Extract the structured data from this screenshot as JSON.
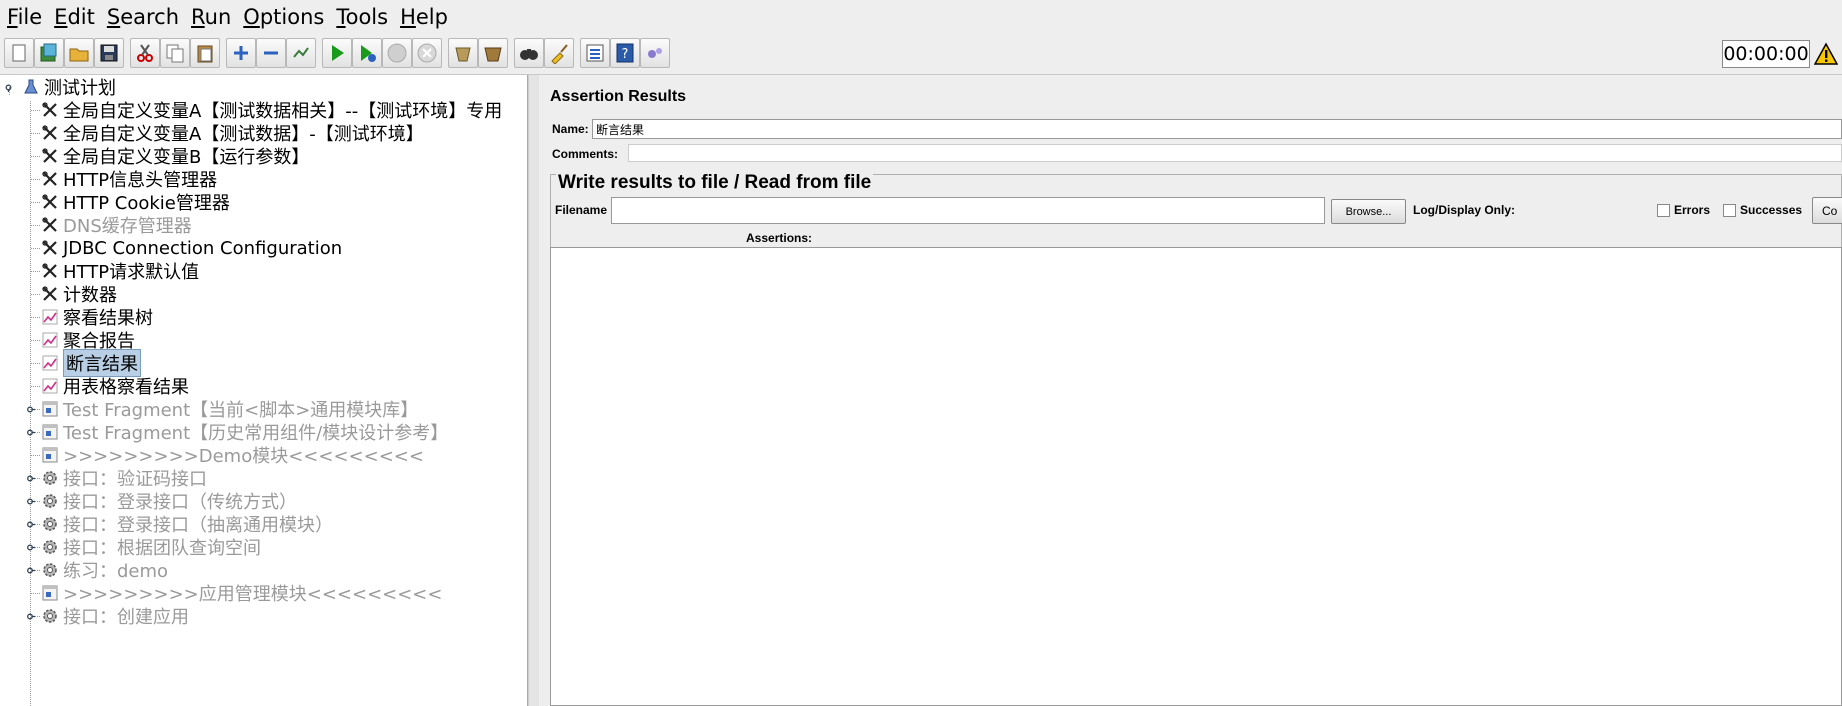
{
  "menubar": {
    "items": [
      {
        "accel": "F",
        "rest": "ile"
      },
      {
        "accel": "E",
        "rest": "dit"
      },
      {
        "accel": "S",
        "rest": "earch"
      },
      {
        "accel": "R",
        "rest": "un"
      },
      {
        "accel": "O",
        "rest": "ptions"
      },
      {
        "accel": "T",
        "rest": "ools"
      },
      {
        "accel": "H",
        "rest": "elp"
      }
    ]
  },
  "toolbar": {
    "timer": "00:00:00"
  },
  "tree": {
    "root": "测试计划",
    "items": [
      {
        "label": "全局自定义变量A【测试数据相关】--【测试环境】专用",
        "icon": "wrench-icon",
        "disabled": false
      },
      {
        "label": "全局自定义变量A【测试数据】-【测试环境】",
        "icon": "wrench-icon",
        "disabled": false
      },
      {
        "label": "全局自定义变量B【运行参数】",
        "icon": "wrench-icon",
        "disabled": false
      },
      {
        "label": "HTTP信息头管理器",
        "icon": "wrench-icon",
        "disabled": false
      },
      {
        "label": "HTTP Cookie管理器",
        "icon": "wrench-icon",
        "disabled": false
      },
      {
        "label": "DNS缓存管理器",
        "icon": "wrench-icon",
        "disabled": true
      },
      {
        "label": "JDBC Connection Configuration",
        "icon": "wrench-icon",
        "disabled": false
      },
      {
        "label": "HTTP请求默认值",
        "icon": "wrench-icon",
        "disabled": false
      },
      {
        "label": "计数器",
        "icon": "wrench-icon",
        "disabled": false
      },
      {
        "label": "察看结果树",
        "icon": "graph-icon",
        "disabled": false
      },
      {
        "label": "聚合报告",
        "icon": "graph-icon",
        "disabled": false
      },
      {
        "label": "断言结果",
        "icon": "graph-icon",
        "disabled": false,
        "selected": true
      },
      {
        "label": "用表格察看结果",
        "icon": "graph-icon",
        "disabled": false
      },
      {
        "label": "Test Fragment【当前<脚本>通用模块库】",
        "icon": "fragment-icon",
        "disabled": true,
        "expander": true
      },
      {
        "label": "Test Fragment【历史常用组件/模块设计参考】",
        "icon": "fragment-icon",
        "disabled": true,
        "expander": true
      },
      {
        "label": ">>>>>>>>>Demo模块<<<<<<<<<",
        "icon": "fragment-icon",
        "disabled": true
      },
      {
        "label": "接口：验证码接口",
        "icon": "gear-icon",
        "disabled": true,
        "expander": true
      },
      {
        "label": "接口：登录接口（传统方式）",
        "icon": "gear-icon",
        "disabled": true,
        "expander": true
      },
      {
        "label": "接口：登录接口（抽离通用模块）",
        "icon": "gear-icon",
        "disabled": true,
        "expander": true
      },
      {
        "label": "接口：根据团队查询空间",
        "icon": "gear-icon",
        "disabled": true,
        "expander": true
      },
      {
        "label": "练习：demo",
        "icon": "gear-icon",
        "disabled": true,
        "expander": true
      },
      {
        "label": ">>>>>>>>>应用管理模块<<<<<<<<<",
        "icon": "fragment-icon",
        "disabled": true
      },
      {
        "label": "接口：创建应用",
        "icon": "gear-icon",
        "disabled": true,
        "expander": true
      }
    ]
  },
  "panel": {
    "title": "Assertion Results",
    "name_label": "Name:",
    "name_value": "断言结果",
    "comments_label": "Comments:",
    "group_title": "Write results to file / Read from file",
    "filename_label": "Filename",
    "browse_label": "Browse...",
    "log_display_label": "Log/Display Only:",
    "errors_label": "Errors",
    "successes_label": "Successes",
    "configure_label": "Co",
    "assertions_header": "Assertions:"
  }
}
